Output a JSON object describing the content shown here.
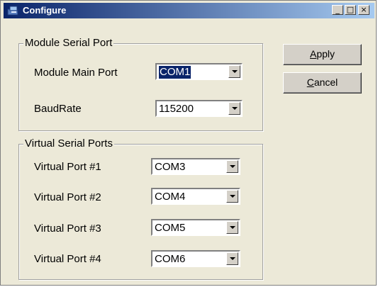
{
  "window": {
    "title": "Configure"
  },
  "titlebar_buttons": {
    "minimize": "_",
    "maximize": "□",
    "close": "×"
  },
  "module_group": {
    "label": "Module Serial Port",
    "main_port_label": "Module Main Port",
    "main_port_value": "COM1",
    "baudrate_label": "BaudRate",
    "baudrate_value": "115200"
  },
  "virtual_group": {
    "label": "Virtual Serial Ports",
    "ports": [
      {
        "label": "Virtual Port #1",
        "value": "COM3"
      },
      {
        "label": "Virtual Port #2",
        "value": "COM4"
      },
      {
        "label": "Virtual Port #3",
        "value": "COM5"
      },
      {
        "label": "Virtual Port #4",
        "value": "COM6"
      }
    ]
  },
  "buttons": {
    "apply_first": "A",
    "apply_rest": "pply",
    "cancel_first": "C",
    "cancel_rest": "ancel"
  },
  "icons": {
    "app": "configure-app-icon",
    "dropdown": "chevron-down-icon"
  },
  "colors": {
    "titlebar_start": "#0a246a",
    "titlebar_end": "#a6caf0",
    "selection": "#0a246a",
    "face": "#ece9d8"
  }
}
